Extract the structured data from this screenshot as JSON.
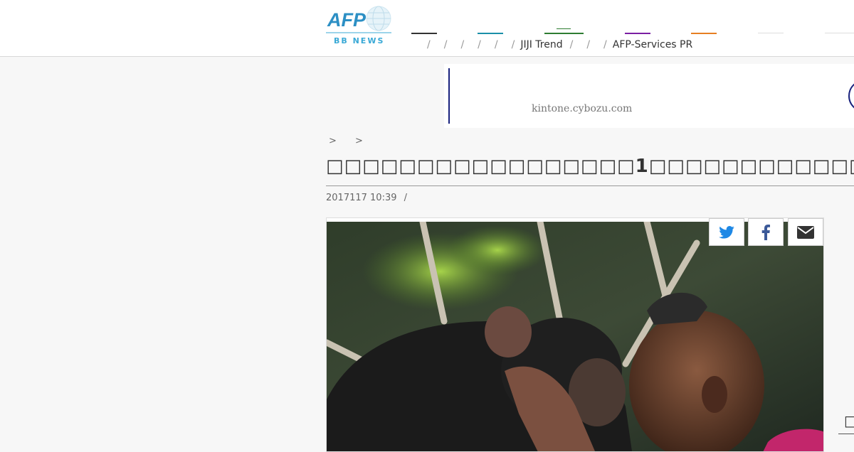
{
  "header": {
    "logo_text": "AFP",
    "logo_sub": "BB NEWS",
    "nav": {
      "separator": "/",
      "items": [
        {
          "label": "",
          "color": "#333333"
        },
        {
          "label": "",
          "color": "#1a8fa8"
        },
        {
          "label": "",
          "color": "#2e7d32"
        },
        {
          "label": "",
          "color": "#7b1fa2"
        },
        {
          "label": "",
          "color": "#e67e22"
        },
        {
          "label": "",
          "color": "#dddddd"
        },
        {
          "label": "",
          "color": "#dddddd"
        }
      ],
      "links": [
        "JIJI Trend",
        "AFP-Services PR"
      ]
    }
  },
  "ad": {
    "url": "kintone.cybozu.com",
    "accent": "#1a237e"
  },
  "article": {
    "breadcrumb": [
      ">",
      ">"
    ],
    "title": "1",
    "date": "2017117 10:39",
    "date_sep": "/",
    "share": {
      "twitter_icon": "twitter-icon",
      "facebook_icon": "facebook-icon",
      "mail_icon": "mail-icon"
    }
  },
  "side": {
    "box_text": ""
  }
}
